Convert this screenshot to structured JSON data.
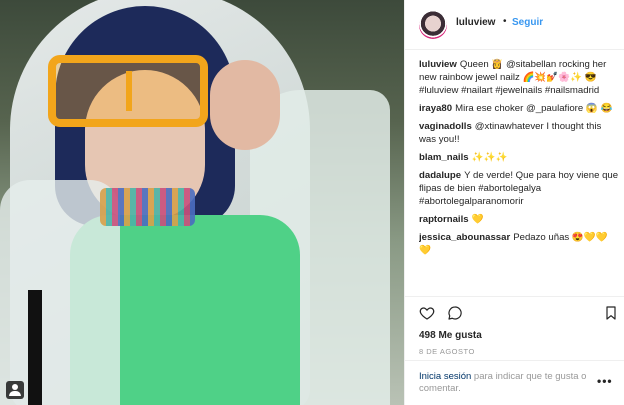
{
  "post": {
    "author": "luluview",
    "separator": "•",
    "follow_label": "Seguir",
    "comments": [
      {
        "user": "luluview",
        "text": "Queen 👸 @sitabellan rocking her new rainbow jewel nailz 🌈💥💅🌸✨ 😎 #luluview #nailart #jewelnails #nailsmadrid"
      },
      {
        "user": "iraya80",
        "text": "Mira ese choker @_paulafiore 😱 😂"
      },
      {
        "user": "vaginadolls",
        "text": "@xtinawhatever I thought this was you!!"
      },
      {
        "user": "blam_nails",
        "text": "✨✨✨"
      },
      {
        "user": "dadalupe",
        "text": "Y de verde! Que para hoy viene que flipas de bien #abortolegalya #abortolegalparanomorir"
      },
      {
        "user": "raptornails",
        "text": "💛"
      },
      {
        "user": "jessica_abounassar",
        "text": "Pedazo uñas 😍💛💛 💛"
      }
    ],
    "likes": "498 Me gusta",
    "date": "8 DE AGOSTO",
    "login_link": "Inicia sesión",
    "login_text": "para indicar que te gusta o comentar.",
    "more_label": "•••"
  },
  "icons": {
    "heart": "heart-icon",
    "comment": "comment-icon",
    "bookmark": "bookmark-icon",
    "user_tag": "user-tag-icon"
  },
  "colors": {
    "link_blue": "#3897f0",
    "text": "#262626",
    "muted": "#999999",
    "border": "#efefef"
  }
}
